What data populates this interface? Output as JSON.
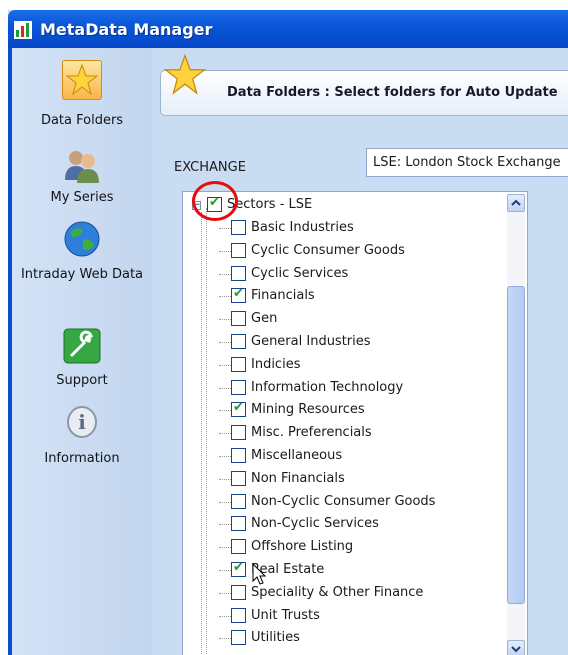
{
  "window": {
    "title": "MetaData Manager"
  },
  "sidebar": {
    "items": [
      {
        "label": "Data Folders",
        "icon": "star-icon",
        "active": true
      },
      {
        "label": "My Series",
        "icon": "users-icon",
        "active": false
      },
      {
        "label": "Intraday Web Data",
        "icon": "globe-icon",
        "active": false
      },
      {
        "label": "Support",
        "icon": "wrench-icon",
        "active": false
      },
      {
        "label": "Information",
        "icon": "info-icon",
        "active": false
      }
    ]
  },
  "panel": {
    "title": "Data Folders : Select folders for Auto Update"
  },
  "exchange": {
    "label": "EXCHANGE",
    "selected": "LSE: London Stock Exchange"
  },
  "tree": {
    "root": {
      "label": "Sectors - LSE",
      "checked": true
    },
    "items": [
      {
        "label": "Basic Industries",
        "checked": false
      },
      {
        "label": "Cyclic Consumer Goods",
        "checked": false
      },
      {
        "label": "Cyclic Services",
        "checked": false
      },
      {
        "label": "Financials",
        "checked": true
      },
      {
        "label": "Gen",
        "checked": false
      },
      {
        "label": "General Industries",
        "checked": false
      },
      {
        "label": "Indicies",
        "checked": false
      },
      {
        "label": "Information Technology",
        "checked": false
      },
      {
        "label": "Mining Resources",
        "checked": true
      },
      {
        "label": "Misc. Preferencials",
        "checked": false
      },
      {
        "label": "Miscellaneous",
        "checked": false
      },
      {
        "label": "Non Financials",
        "checked": false
      },
      {
        "label": "Non-Cyclic Consumer Goods",
        "checked": false
      },
      {
        "label": "Non-Cyclic Services",
        "checked": false
      },
      {
        "label": "Offshore Listing",
        "checked": false
      },
      {
        "label": "Real Estate",
        "checked": true
      },
      {
        "label": "Speciality & Other Finance",
        "checked": false
      },
      {
        "label": "Unit Trusts",
        "checked": false
      },
      {
        "label": "Utilities",
        "checked": false
      }
    ]
  },
  "colors": {
    "titlebar": "#0a56d9",
    "check": "#21a121",
    "highlight_ring": "#e40c0c"
  }
}
